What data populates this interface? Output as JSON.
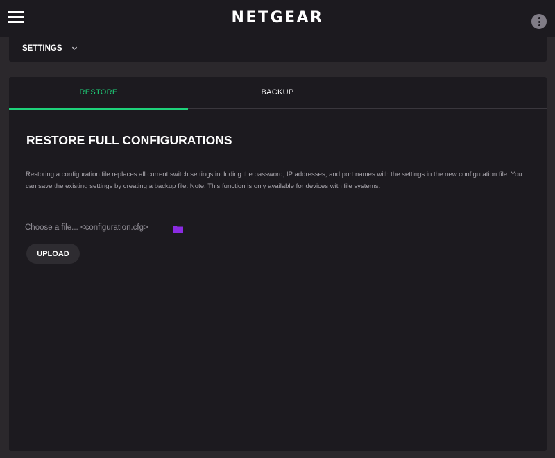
{
  "header": {
    "logo": "NETGEAR",
    "menu_icon": "hamburger-menu-icon",
    "more_icon": "more-vertical-icon"
  },
  "settings_bar": {
    "label": "SETTINGS",
    "icon": "chevron-down-icon"
  },
  "tabs": [
    {
      "label": "RESTORE",
      "active": true
    },
    {
      "label": "BACKUP",
      "active": false
    }
  ],
  "restore": {
    "title": "RESTORE FULL CONFIGURATIONS",
    "description": "Restoring a configuration file replaces all current switch settings including the password, IP addresses, and port names with the settings in the new configuration file. You can save the existing settings by creating a backup file. Note: This function is only available for devices with file systems.",
    "file_input": {
      "value": "",
      "placeholder": "Choose a file... <configuration.cfg>"
    },
    "folder_icon": "folder-icon",
    "upload_label": "UPLOAD"
  },
  "colors": {
    "accent_green": "#1ed27a",
    "folder_purple": "#8a2be2",
    "background": "#1c1a1f"
  }
}
